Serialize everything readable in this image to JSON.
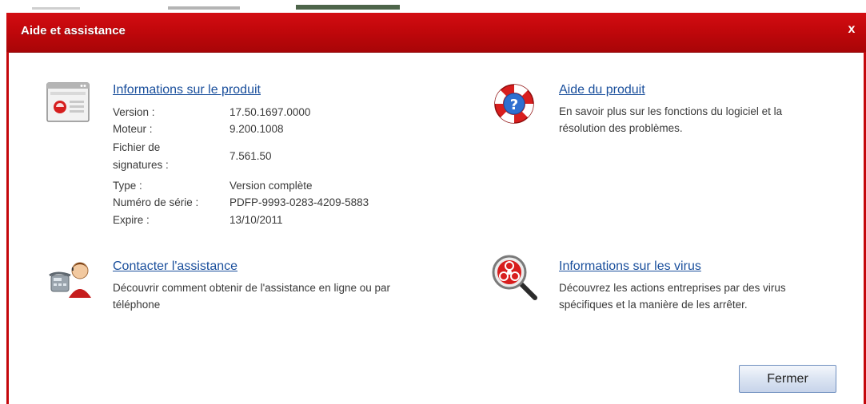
{
  "dialog": {
    "title": "Aide et assistance",
    "close_label": "x"
  },
  "product_info": {
    "heading": "Informations sur le produit",
    "rows": [
      {
        "label": "Version :",
        "value": "17.50.1697.0000"
      },
      {
        "label": "Moteur :",
        "value": "9.200.1008"
      },
      {
        "label": "Fichier de",
        "label2": "signatures :",
        "value": "7.561.50"
      },
      {
        "label": "Type :",
        "value": "Version complète"
      },
      {
        "label": "Numéro de série :",
        "value": "PDFP-9993-0283-4209-5883"
      },
      {
        "label": "Expire :",
        "value": "13/10/2011"
      }
    ]
  },
  "product_help": {
    "heading": "Aide du produit",
    "description": "En savoir plus sur les fonctions du logiciel et la résolution des problèmes."
  },
  "contact_support": {
    "heading": "Contacter l'assistance",
    "description": "Découvrir comment obtenir de l'assistance en ligne ou par téléphone"
  },
  "virus_info": {
    "heading": "Informations sur les virus",
    "description": "Découvrez les actions entreprises par des virus spécifiques et la manière de les arrêter."
  },
  "buttons": {
    "close": "Fermer"
  }
}
